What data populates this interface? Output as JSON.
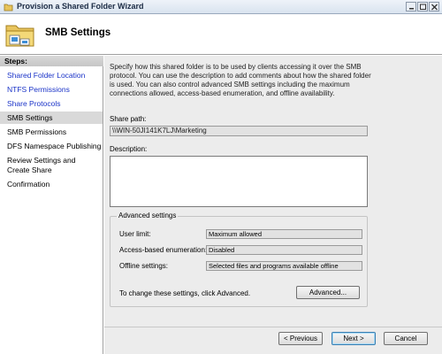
{
  "window": {
    "title": "Provision a Shared Folder Wizard"
  },
  "header": {
    "title": "SMB Settings",
    "icon": "shared-folder-icon"
  },
  "steps": {
    "heading": "Steps:",
    "items": [
      {
        "label": "Shared Folder Location",
        "state": "link"
      },
      {
        "label": "NTFS Permissions",
        "state": "link"
      },
      {
        "label": "Share Protocols",
        "state": "link"
      },
      {
        "label": "SMB Settings",
        "state": "current"
      },
      {
        "label": "SMB Permissions",
        "state": "pending"
      },
      {
        "label": "DFS Namespace Publishing",
        "state": "pending"
      },
      {
        "label": "Review Settings and Create Share",
        "state": "pending"
      },
      {
        "label": "Confirmation",
        "state": "pending"
      }
    ]
  },
  "main": {
    "intro": "Specify how this shared folder is to be used by clients accessing it over the SMB protocol. You can use the description to add comments about how the shared folder is used. You can also control advanced SMB settings including the maximum connections allowed, access-based enumeration, and offline availability.",
    "share_path_label": "Share path:",
    "share_path_value": "\\\\WIN-50JI141K7LJ\\Marketing",
    "description_label": "Description:",
    "description_value": "",
    "advanced": {
      "title": "Advanced settings",
      "user_limit_label": "User limit:",
      "user_limit_value": "Maximum allowed",
      "abe_label": "Access-based enumeration:",
      "abe_value": "Disabled",
      "offline_label": "Offline settings:",
      "offline_value": "Selected files and programs available offline",
      "note": "To change these settings, click Advanced.",
      "button": "Advanced..."
    }
  },
  "footer": {
    "previous": "< Previous",
    "next": "Next >",
    "cancel": "Cancel"
  },
  "colors": {
    "link": "#1a33c8",
    "panel": "#ececec",
    "current_step": "#d9d9d9"
  }
}
